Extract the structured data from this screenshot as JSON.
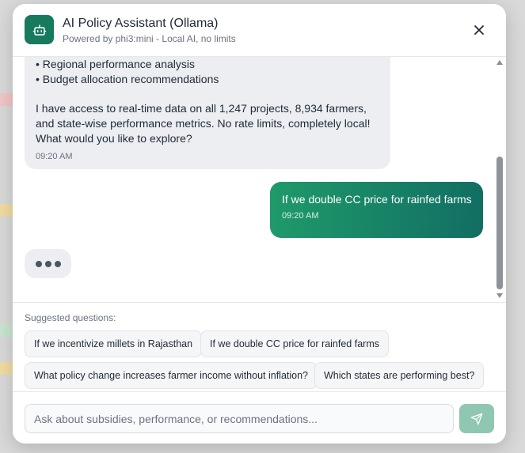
{
  "header": {
    "title": "AI Policy Assistant (Ollama)",
    "subtitle": "Powered by phi3:mini - Local AI, no limits"
  },
  "messages": {
    "bot": {
      "lines": [
        "• Regional performance analysis",
        "• Budget allocation recommendations",
        "I have access to real-time data on all 1,247 projects, 8,934 farmers,",
        "and state-wise performance metrics. No rate limits, completely local!",
        "What would you like to explore?"
      ],
      "time": "09:20 AM"
    },
    "user": {
      "text": "If we double CC price for rainfed farms",
      "time": "09:20 AM"
    }
  },
  "suggestions": {
    "label": "Suggested questions:",
    "items": [
      "If we incentivize millets in Rajasthan",
      "If we double CC price for rainfed farms",
      "What policy change increases farmer income without inflation?",
      "Which states are performing best?"
    ]
  },
  "composer": {
    "placeholder": "Ask about subsidies, performance, or recommendations..."
  },
  "colors": {
    "brand": "#157a5e",
    "user_bubble_start": "#1f9a6a",
    "user_bubble_end": "#126e63",
    "send_button": "#8fc7b2",
    "bot_bubble": "#eceef1"
  },
  "icons": {
    "logo": "robot-icon",
    "close": "close-icon",
    "send": "send-icon"
  }
}
